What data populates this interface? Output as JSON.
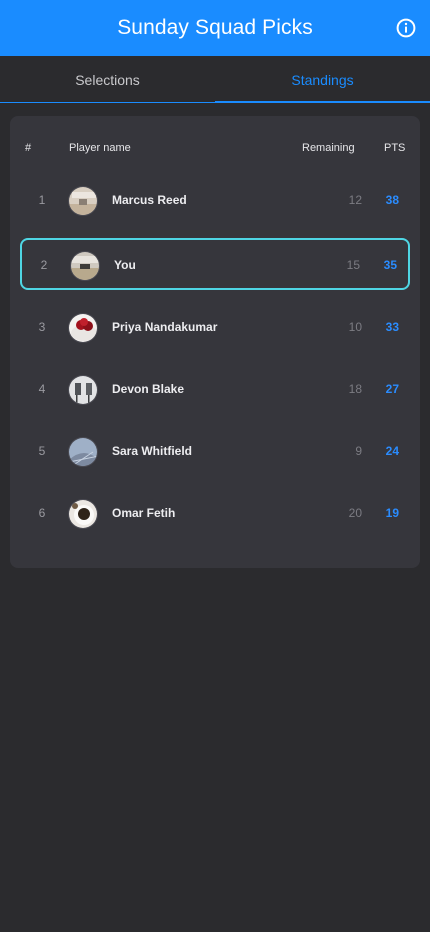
{
  "header": {
    "title": "Sunday Squad Picks",
    "info_icon": "info-icon"
  },
  "tabs": [
    {
      "label": "Selections",
      "active": false
    },
    {
      "label": "Standings",
      "active": true
    }
  ],
  "standings": {
    "columns": {
      "rank": "#",
      "name": "Player name",
      "remaining": "Remaining",
      "pts": "PTS"
    },
    "rows": [
      {
        "rank": "1",
        "name": "Marcus Reed",
        "remaining": "12",
        "pts": "38",
        "avatar": "avatar-photo-sand"
      },
      {
        "rank": "2",
        "name": "You",
        "remaining": "15",
        "pts": "35",
        "avatar": "avatar-photo-beach",
        "highlight": true
      },
      {
        "rank": "3",
        "name": "Priya Nandakumar",
        "remaining": "10",
        "pts": "33",
        "avatar": "avatar-photo-berries"
      },
      {
        "rank": "4",
        "name": "Devon Blake",
        "remaining": "18",
        "pts": "27",
        "avatar": "avatar-photo-chairs"
      },
      {
        "rank": "5",
        "name": "Sara Whitfield",
        "remaining": "9",
        "pts": "24",
        "avatar": "avatar-photo-dome"
      },
      {
        "rank": "6",
        "name": "Omar Fetih",
        "remaining": "20",
        "pts": "19",
        "avatar": "avatar-photo-coffee"
      }
    ]
  },
  "colors": {
    "header_bg": "#1a8cff",
    "accent": "#1a8cff",
    "highlight_border": "#4fd6e4",
    "background": "#2b2b2e",
    "card": "#36363c"
  }
}
